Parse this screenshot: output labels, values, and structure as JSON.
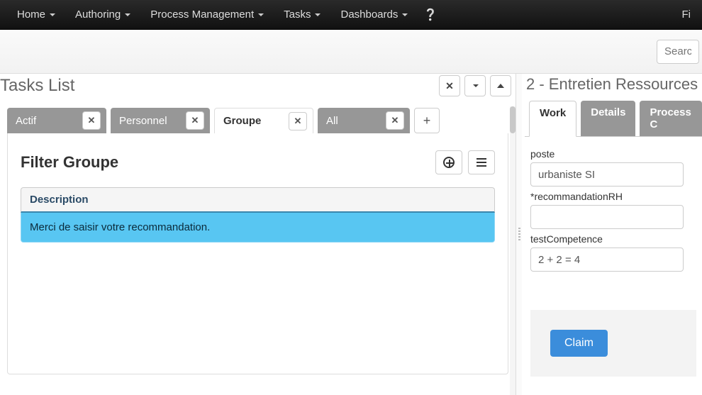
{
  "nav": {
    "items": [
      "Home",
      "Authoring",
      "Process Management",
      "Tasks",
      "Dashboards"
    ],
    "right_cut": "Fi"
  },
  "search": {
    "placeholder": "Search"
  },
  "left": {
    "title": "Tasks List",
    "tabs": [
      {
        "label": "Actif"
      },
      {
        "label": "Personnel"
      },
      {
        "label": "Groupe"
      },
      {
        "label": "All"
      }
    ],
    "filter_title": "Filter Groupe",
    "col_header": "Description",
    "task_row": "Merci de saisir votre recommandation."
  },
  "right": {
    "title": "2 - Entretien Ressources",
    "tabs": [
      "Work",
      "Details",
      "Process C"
    ],
    "fields": {
      "poste_label": "poste",
      "poste_value": "urbaniste SI",
      "reco_label": "*recommandationRH",
      "reco_value": "",
      "test_label": "testCompetence",
      "test_value": "2 + 2 = 4"
    },
    "claim": "Claim"
  }
}
